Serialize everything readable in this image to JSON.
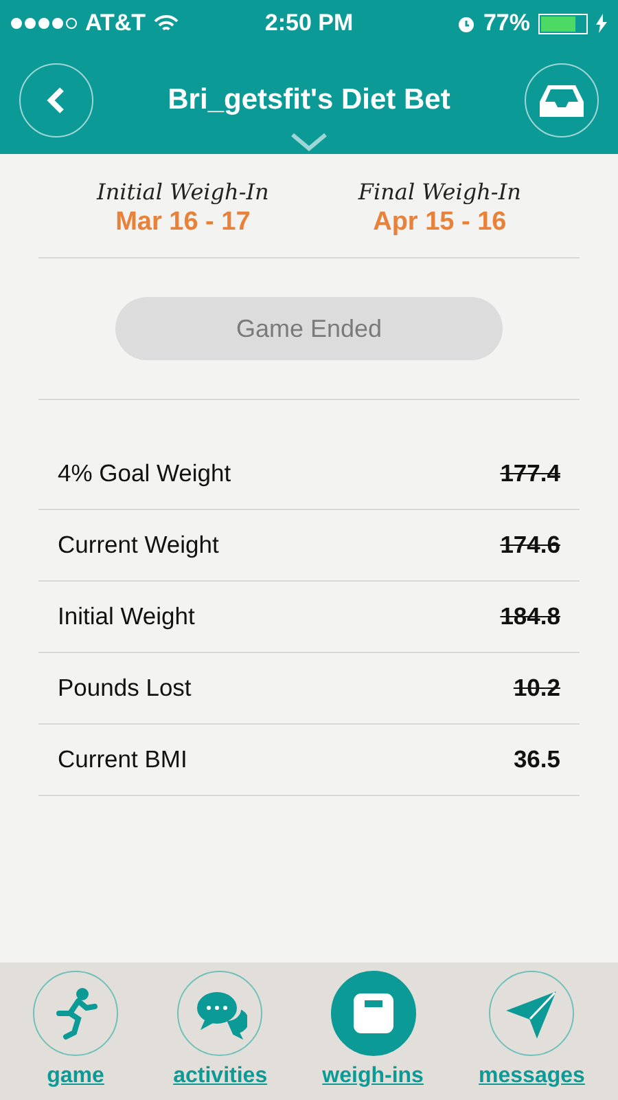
{
  "status_bar": {
    "carrier": "AT&T",
    "time": "2:50 PM",
    "battery": "77%"
  },
  "nav": {
    "title": "Bri_getsfit's Diet Bet"
  },
  "weigh_ins": [
    {
      "label": "Initial Weigh-In",
      "dates": "Mar 16 - 17"
    },
    {
      "label": "Final Weigh-In",
      "dates": "Apr 15 - 16"
    }
  ],
  "game_button": {
    "label": "Game Ended",
    "disabled": true
  },
  "stats": [
    {
      "label": "4% Goal Weight",
      "value": "177.4",
      "struck": true
    },
    {
      "label": "Current Weight",
      "value": "174.6",
      "struck": true
    },
    {
      "label": "Initial Weight",
      "value": "184.8",
      "struck": true
    },
    {
      "label": "Pounds Lost",
      "value": "10.2",
      "struck": true
    },
    {
      "label": "Current BMI",
      "value": "36.5",
      "struck": false
    }
  ],
  "tabs": [
    {
      "kind": "game",
      "label": "game",
      "selected": false
    },
    {
      "kind": "activities",
      "label": "activities",
      "selected": false
    },
    {
      "kind": "weighins",
      "label": "weigh-ins",
      "selected": true
    },
    {
      "kind": "messages",
      "label": "messages",
      "selected": false
    }
  ]
}
